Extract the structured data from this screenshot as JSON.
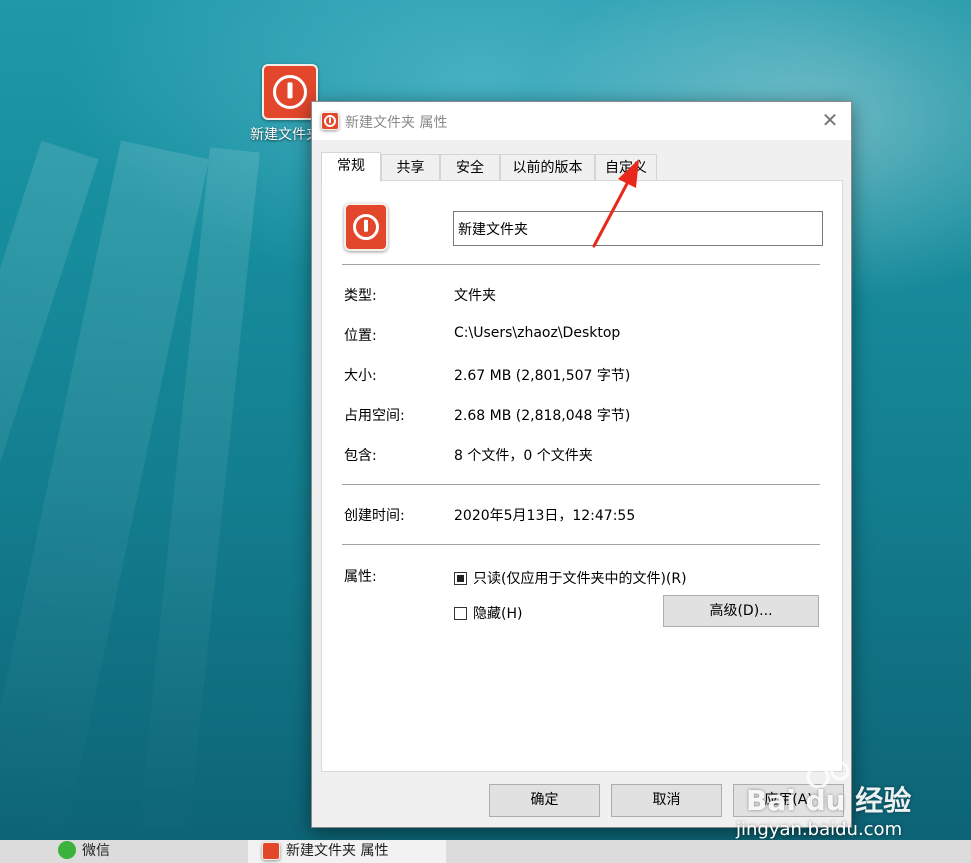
{
  "desktop": {
    "icon_label": "新建文件夹"
  },
  "dialog": {
    "title": "新建文件夹 属性",
    "close_glyph": "✕",
    "tabs": [
      {
        "label": "常规",
        "active": true
      },
      {
        "label": "共享",
        "active": false
      },
      {
        "label": "安全",
        "active": false
      },
      {
        "label": "以前的版本",
        "active": false
      },
      {
        "label": "自定义",
        "active": false
      }
    ],
    "folder_name": "新建文件夹",
    "fields": {
      "type_label": "类型:",
      "type_value": "文件夹",
      "location_label": "位置:",
      "location_value": "C:\\Users\\zhaoz\\Desktop",
      "size_label": "大小:",
      "size_value": "2.67 MB (2,801,507 字节)",
      "size_on_disk_label": "占用空间:",
      "size_on_disk_value": "2.68 MB (2,818,048 字节)",
      "contains_label": "包含:",
      "contains_value": "8 个文件，0 个文件夹",
      "created_label": "创建时间:",
      "created_value": "2020年5月13日，12:47:55",
      "attributes_label": "属性:"
    },
    "readonly_checkbox": {
      "label": "只读(仅应用于文件夹中的文件)(R)",
      "state": "indeterminate"
    },
    "hidden_checkbox": {
      "label": "隐藏(H)",
      "state": "unchecked"
    },
    "advanced_button": "高级(D)...",
    "buttons": {
      "ok": "确定",
      "cancel": "取消",
      "apply": "应用(A)"
    }
  },
  "taskbar": {
    "items": [
      {
        "label": "微信",
        "icon": "wechat-icon"
      },
      {
        "label": "新建文件夹 属性",
        "icon": "app-icon"
      }
    ]
  },
  "watermark": {
    "brand": "Bai du 经验",
    "url": "jingyan.baidu.com"
  },
  "colors": {
    "app_icon_red": "#e2462b",
    "annotation_arrow": "#e8281a"
  }
}
